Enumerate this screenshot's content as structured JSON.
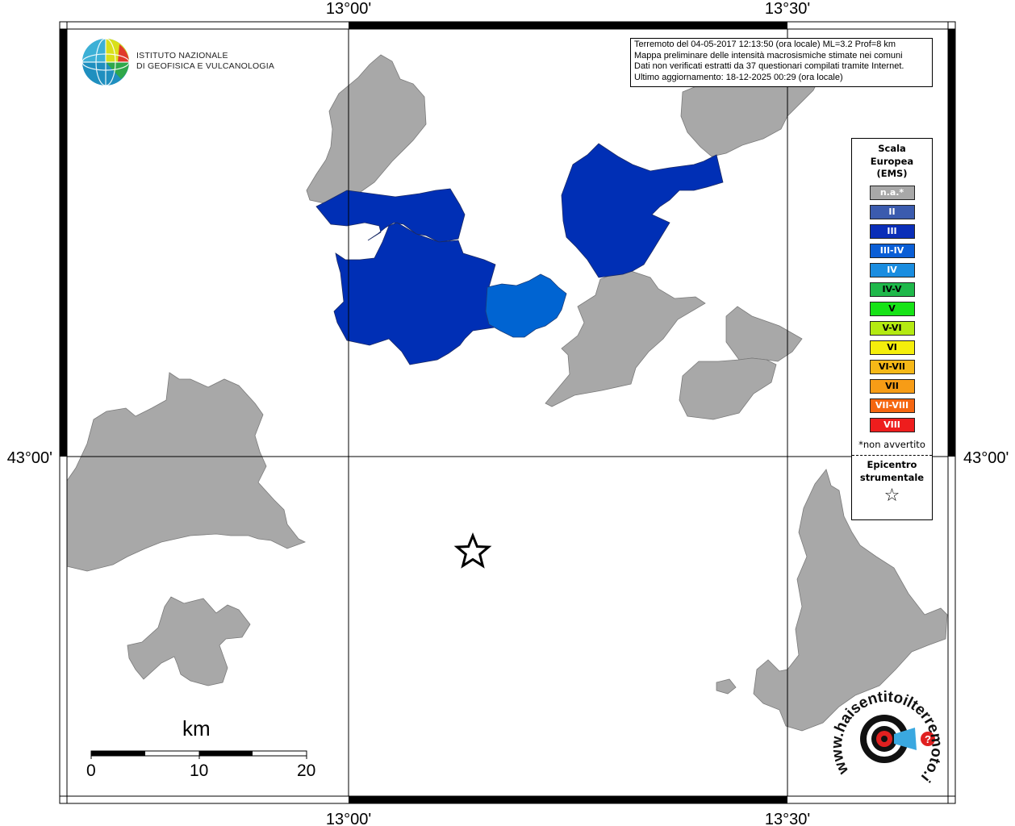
{
  "axes": {
    "top_left": "13°00'",
    "top_right": "13°30'",
    "bottom_left": "13°00'",
    "bottom_right": "13°30'",
    "left": "43°00'",
    "right": "43°00'"
  },
  "info_box": {
    "line1": "Terremoto del 04-05-2017 12:13:50 (ora locale) ML=3.2 Prof=8 km",
    "line2": "Mappa preliminare delle intensità macrosismiche stimate nei comuni",
    "line3": "Dati non verificati estratti da 37 questionari compilati tramite Internet.",
    "line4": "Ultimo aggiornamento: 18-12-2025 00:29 (ora locale)"
  },
  "logo": {
    "line1": "ISTITUTO NAZIONALE",
    "line2": "DI GEOFISICA E VULCANOLOGIA"
  },
  "legend": {
    "title_line1": "Scala",
    "title_line2": "Europea",
    "title_line3": "(EMS)",
    "items": [
      {
        "label": "n.a.*",
        "color": "#a8a8a8"
      },
      {
        "label": "II",
        "color": "#3b5bae"
      },
      {
        "label": "III",
        "color": "#0a2eb8"
      },
      {
        "label": "III-IV",
        "color": "#0a5ed6"
      },
      {
        "label": "IV",
        "color": "#1a8de0"
      },
      {
        "label": "IV-V",
        "color": "#1fb84a"
      },
      {
        "label": "V",
        "color": "#17e317"
      },
      {
        "label": "V-VI",
        "color": "#b4ea12"
      },
      {
        "label": "VI",
        "color": "#f4ee0c"
      },
      {
        "label": "VI-VII",
        "color": "#f6b817"
      },
      {
        "label": "VII",
        "color": "#f79c16"
      },
      {
        "label": "VII-VIII",
        "color": "#f56610"
      },
      {
        "label": "VIII",
        "color": "#ee1d1d"
      }
    ],
    "note": "*non avvertito",
    "epicenter_line1": "Epicentro",
    "epicenter_line2": "strumentale",
    "epicenter_symbol": "☆"
  },
  "scale_bar": {
    "unit": "km",
    "labels": [
      "0",
      "10",
      "20"
    ]
  },
  "watermark": {
    "text": "www.haisentitoilterremoto.it",
    "badge": "?"
  },
  "colors": {
    "municipality_na": "#a8a8a8",
    "intensity_III": "#002fb5",
    "intensity_III_IV": "#0064d2"
  }
}
